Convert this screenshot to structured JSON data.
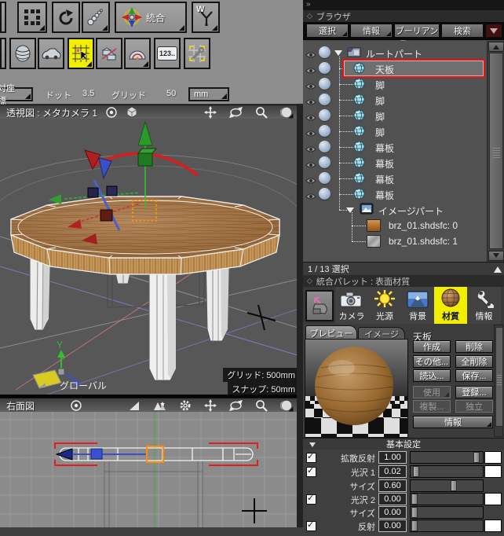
{
  "toolbar": {
    "integrated_label": "統合",
    "w_label": "W",
    "numeric_label": "123.."
  },
  "coord_bar": {
    "coord_label": "対座標",
    "dot_label": "ドット",
    "dot_value": "3.5",
    "grid_label": "グリッド",
    "grid_value": "50",
    "unit_label": "mm"
  },
  "perspective_view": {
    "title": "透視図 : メタカメラ 1",
    "global_label": "グローバル",
    "axis_y_label": "Y",
    "grid_info": "グリッド: 500mm",
    "snap_info": "スナップ: 50mm"
  },
  "side_view": {
    "title": "右面図"
  },
  "browser": {
    "panel_title": "ブラウザ",
    "collapse_glyph": "»",
    "tabs": [
      {
        "label": "選択"
      },
      {
        "label": "情報"
      },
      {
        "label": "ブーリアン"
      },
      {
        "label": "検索"
      }
    ],
    "items": [
      {
        "label": "ルートパート",
        "type": "part"
      },
      {
        "label": "天板",
        "type": "shape",
        "selected": true
      },
      {
        "label": "脚",
        "type": "shape"
      },
      {
        "label": "脚",
        "type": "shape"
      },
      {
        "label": "脚",
        "type": "shape"
      },
      {
        "label": "脚",
        "type": "shape"
      },
      {
        "label": "幕板",
        "type": "shape"
      },
      {
        "label": "幕板",
        "type": "shape"
      },
      {
        "label": "幕板",
        "type": "shape"
      },
      {
        "label": "幕板",
        "type": "shape"
      },
      {
        "label": "イメージパート",
        "type": "image-part"
      },
      {
        "label": "brz_01.shdsfc: 0",
        "type": "texture-orange"
      },
      {
        "label": "brz_01.shdsfc: 1",
        "type": "texture-grey"
      }
    ],
    "status": "1 / 13 選択"
  },
  "palette": {
    "panel_title": "統合パレット : 表面材質",
    "tabs": [
      {
        "label": "カメラ"
      },
      {
        "label": "光源"
      },
      {
        "label": "背景"
      },
      {
        "label": "材質",
        "active": true
      },
      {
        "label": "情報"
      }
    ],
    "preview_tab": "プレビュー",
    "image_tab": "イメージ",
    "target_name": "天板",
    "buttons": {
      "create": "作成",
      "delete": "削除",
      "other": "その他...",
      "delete_all": "全削除",
      "load": "読込...",
      "save": "保存...",
      "use": "使用",
      "register": "登録...",
      "duplicate": "複製...",
      "independent": "独立",
      "info": "情報"
    },
    "basic_section_label": "基本設定",
    "rows": [
      {
        "label": "拡散反射",
        "value": "1.00",
        "checkbox": true,
        "swatch": true,
        "thumb_left": "87%"
      },
      {
        "label": "光沢 1",
        "value": "0.02",
        "checkbox": true,
        "swatch": true,
        "thumb_left": "3%"
      },
      {
        "label": "サイズ",
        "value": "0.60",
        "checkbox": false,
        "swatch": false,
        "thumb_left": "55%"
      },
      {
        "label": "光沢 2",
        "value": "0.00",
        "checkbox": true,
        "swatch": true,
        "thumb_left": "1%"
      },
      {
        "label": "サイズ",
        "value": "0.00",
        "checkbox": false,
        "swatch": false,
        "thumb_left": "1%"
      },
      {
        "label": "反射",
        "value": "0.00",
        "checkbox": true,
        "swatch": true,
        "thumb_left": "1%"
      }
    ]
  },
  "colors": {
    "accent_yellow": "#f2ee00",
    "selection_red": "#e81010",
    "wood": "#a9743f",
    "manipulator_green": "#2f9f2f",
    "manipulator_red": "#cc2222",
    "manipulator_orange": "#ff8f00"
  }
}
